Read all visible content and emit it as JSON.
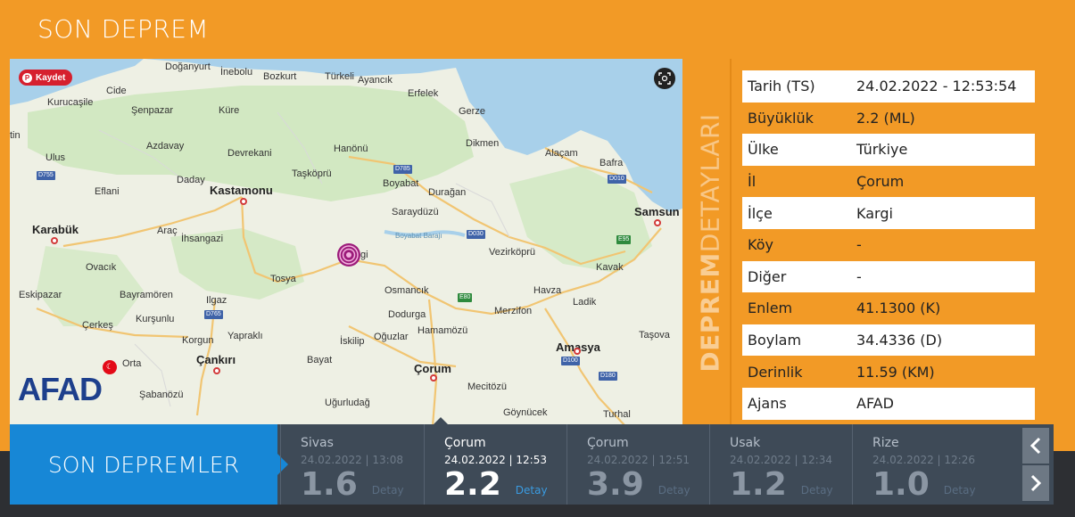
{
  "header": {
    "title": "SON DEPREM"
  },
  "map": {
    "kaydet_label": "Kaydet",
    "logo_text": "AFAD",
    "labels": [
      {
        "t": "Doğanyurt",
        "cls": ""
      },
      {
        "t": "İnebolu",
        "cls": ""
      },
      {
        "t": "Bozkurt",
        "cls": ""
      },
      {
        "t": "Türkeli",
        "cls": ""
      },
      {
        "t": "Ayancık",
        "cls": ""
      },
      {
        "t": "Cide",
        "cls": ""
      },
      {
        "t": "Kurucaşile",
        "cls": ""
      },
      {
        "t": "Şenpazar",
        "cls": ""
      },
      {
        "t": "Küre",
        "cls": ""
      },
      {
        "t": "Erfelek",
        "cls": ""
      },
      {
        "t": "Gerze",
        "cls": ""
      },
      {
        "t": "Azdavay",
        "cls": ""
      },
      {
        "t": "Devrekani",
        "cls": ""
      },
      {
        "t": "Hanönü",
        "cls": ""
      },
      {
        "t": "Dikmen",
        "cls": ""
      },
      {
        "t": "Alaçam",
        "cls": ""
      },
      {
        "t": "Bafra",
        "cls": ""
      },
      {
        "t": "Ulus",
        "cls": ""
      },
      {
        "t": "Taşköprü",
        "cls": ""
      },
      {
        "t": "Boyabat",
        "cls": ""
      },
      {
        "t": "Daday",
        "cls": ""
      },
      {
        "t": "Kastamonu",
        "cls": "big"
      },
      {
        "t": "Durağan",
        "cls": ""
      },
      {
        "t": "Eflani",
        "cls": ""
      },
      {
        "t": "Saraydüzü",
        "cls": ""
      },
      {
        "t": "Samsun",
        "cls": "big"
      },
      {
        "t": "Karabük",
        "cls": "big"
      },
      {
        "t": "Araç",
        "cls": ""
      },
      {
        "t": "İhsangazi",
        "cls": ""
      },
      {
        "t": "Boyabat Barajı",
        "cls": "water"
      },
      {
        "t": "Vezirköprü",
        "cls": ""
      },
      {
        "t": "Ovacık",
        "cls": ""
      },
      {
        "t": "Tosya",
        "cls": ""
      },
      {
        "t": "Kavak",
        "cls": ""
      },
      {
        "t": "Eskipazar",
        "cls": ""
      },
      {
        "t": "Bayramören",
        "cls": ""
      },
      {
        "t": "Ilgaz",
        "cls": ""
      },
      {
        "t": "Osmancık",
        "cls": ""
      },
      {
        "t": "Havza",
        "cls": ""
      },
      {
        "t": "Kurşunlu",
        "cls": ""
      },
      {
        "t": "Dodurga",
        "cls": ""
      },
      {
        "t": "Merzifon",
        "cls": ""
      },
      {
        "t": "Ladik",
        "cls": ""
      },
      {
        "t": "Çerkeş",
        "cls": ""
      },
      {
        "t": "Hamamözü",
        "cls": ""
      },
      {
        "t": "Korgun",
        "cls": ""
      },
      {
        "t": "Yapraklı",
        "cls": ""
      },
      {
        "t": "İskilip",
        "cls": ""
      },
      {
        "t": "Oğuzlar",
        "cls": ""
      },
      {
        "t": "Taşova",
        "cls": ""
      },
      {
        "t": "Amasya",
        "cls": "big"
      },
      {
        "t": "Orta",
        "cls": ""
      },
      {
        "t": "Çankırı",
        "cls": "big"
      },
      {
        "t": "Bayat",
        "cls": ""
      },
      {
        "t": "Çorum",
        "cls": "big"
      },
      {
        "t": "Mecitözü",
        "cls": ""
      },
      {
        "t": "Şabanözü",
        "cls": ""
      },
      {
        "t": "Uğurludağ",
        "cls": ""
      },
      {
        "t": "Göynücek",
        "cls": ""
      },
      {
        "t": "Turhal",
        "cls": ""
      },
      {
        "t": "gi",
        "cls": ""
      },
      {
        "t": "tin",
        "cls": ""
      }
    ],
    "roads": [
      {
        "t": "D755",
        "green": false
      },
      {
        "t": "D785",
        "green": false
      },
      {
        "t": "D010",
        "green": false
      },
      {
        "t": "D030",
        "green": false
      },
      {
        "t": "E95",
        "green": true
      },
      {
        "t": "E80",
        "green": true
      },
      {
        "t": "D765",
        "green": false
      },
      {
        "t": "D100",
        "green": false
      },
      {
        "t": "D180",
        "green": false
      }
    ]
  },
  "details": {
    "vertical_title_bold": "DEPREM",
    "vertical_title_light": "DETAYLARI",
    "rows": [
      {
        "key": "Tarih (TS)",
        "value": "24.02.2022 - 12:53:54"
      },
      {
        "key": "Büyüklük",
        "value": "2.2 (ML)"
      },
      {
        "key": "Ülke",
        "value": "Türkiye"
      },
      {
        "key": "İl",
        "value": "Çorum"
      },
      {
        "key": "İlçe",
        "value": "Kargi"
      },
      {
        "key": "Köy",
        "value": "-"
      },
      {
        "key": "Diğer",
        "value": "-"
      },
      {
        "key": "Enlem",
        "value": "41.1300 (K)"
      },
      {
        "key": "Boylam",
        "value": "34.4336 (D)"
      },
      {
        "key": "Derinlik",
        "value": "11.59 (KM)"
      },
      {
        "key": "Ajans",
        "value": "AFAD"
      }
    ]
  },
  "recent": {
    "title": "SON DEPREMLER",
    "quakes": [
      {
        "loc": "Sivas",
        "date": "24.02.2022 | 13:08",
        "mag": "1.6",
        "detay": "Detay"
      },
      {
        "loc": "Çorum",
        "date": "24.02.2022 | 12:53",
        "mag": "2.2",
        "detay": "Detay"
      },
      {
        "loc": "Çorum",
        "date": "24.02.2022 | 12:51",
        "mag": "3.9",
        "detay": "Detay"
      },
      {
        "loc": "Usak",
        "date": "24.02.2022 | 12:34",
        "mag": "1.2",
        "detay": "Detay"
      },
      {
        "loc": "Rize",
        "date": "24.02.2022 | 12:26",
        "mag": "1.0",
        "detay": "Detay"
      }
    ]
  }
}
